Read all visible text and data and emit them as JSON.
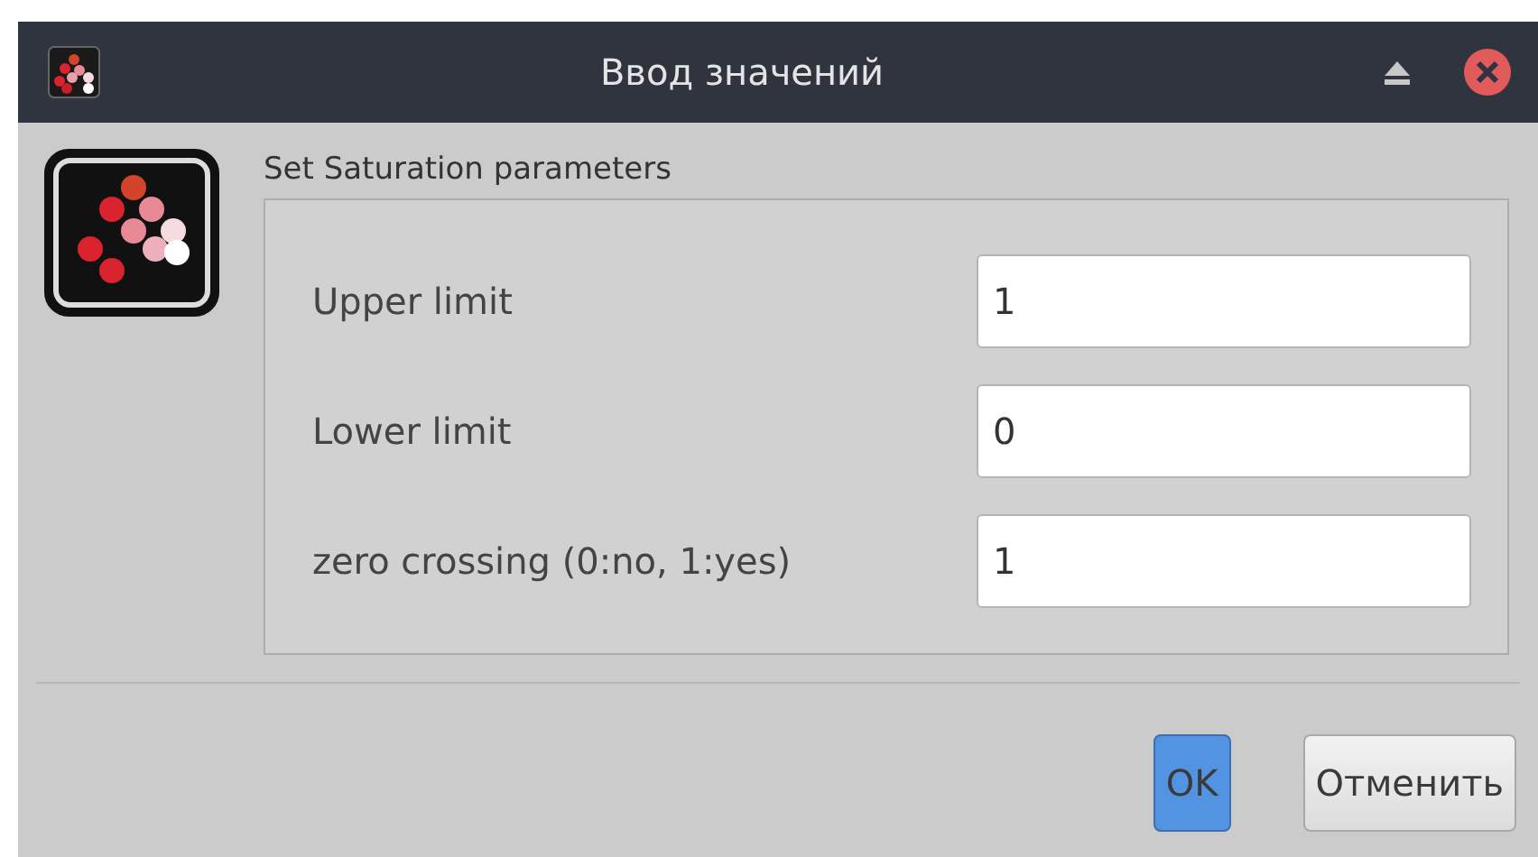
{
  "window": {
    "title": "Ввод значений"
  },
  "heading": "Set Saturation parameters",
  "fields": [
    {
      "label": "Upper limit",
      "value": "1"
    },
    {
      "label": "Lower limit",
      "value": "0"
    },
    {
      "label": "zero crossing (0:no, 1:yes)",
      "value": "1"
    }
  ],
  "buttons": [
    {
      "label": "OK",
      "default": true
    },
    {
      "label": "Отменить",
      "default": false
    }
  ]
}
